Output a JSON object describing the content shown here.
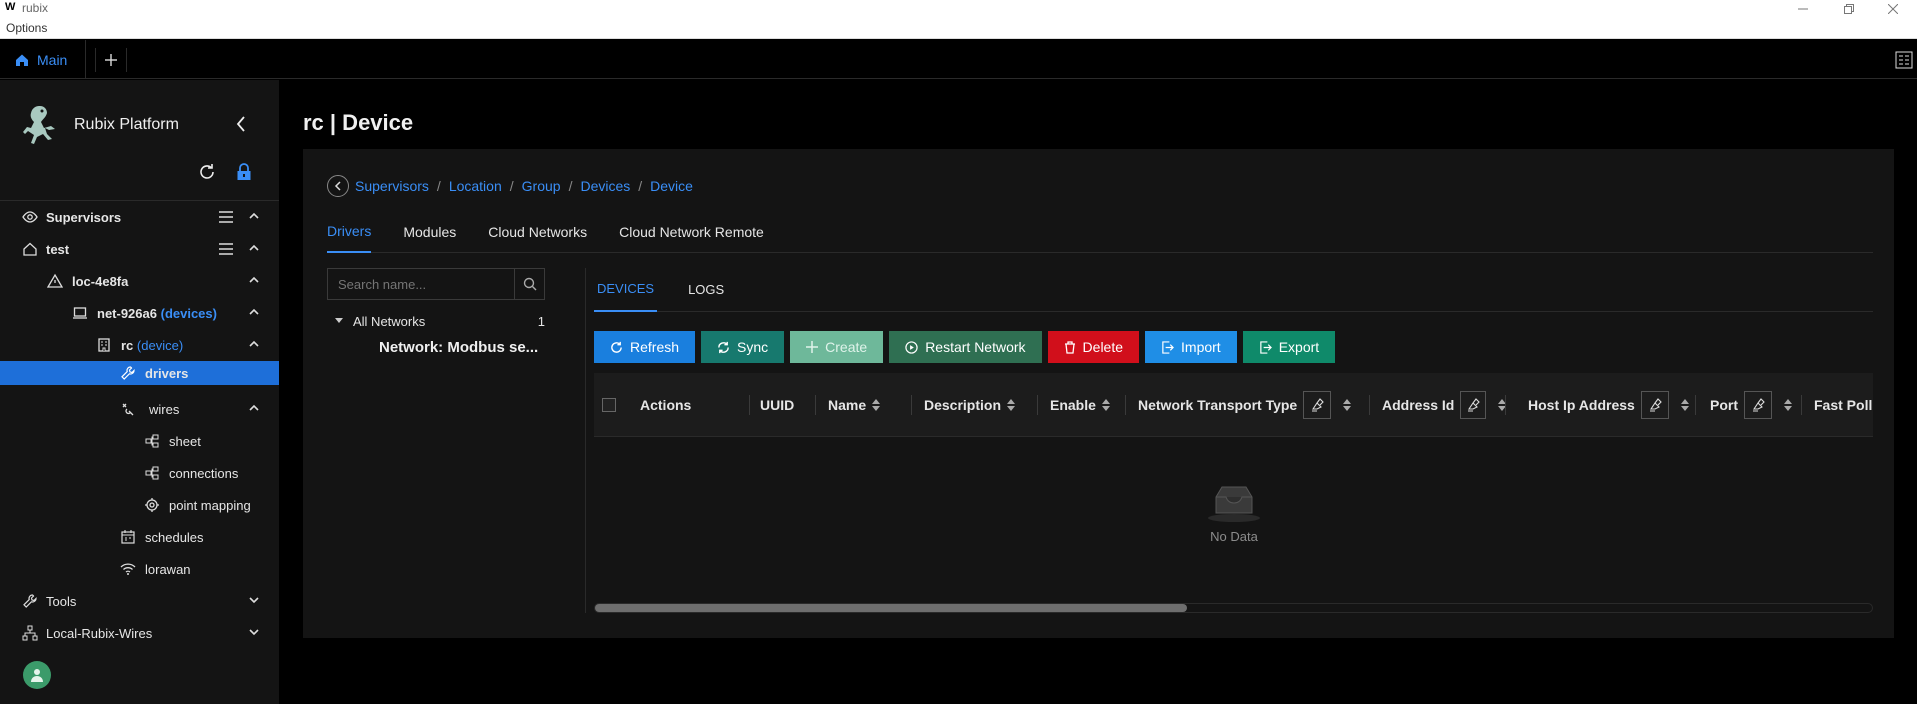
{
  "window": {
    "logo": "W",
    "title": "rubix",
    "menu": "Options"
  },
  "tabs": {
    "main_label": "Main"
  },
  "sidebar": {
    "brand": "Rubix Platform",
    "items": [
      {
        "label": "Supervisors"
      },
      {
        "label": "test"
      },
      {
        "label": "loc-4e8fa"
      },
      {
        "label": "net-926a6",
        "suffix": "(devices)"
      },
      {
        "label": "rc",
        "suffix": "(device)"
      },
      {
        "label": "drivers"
      },
      {
        "label": "wires"
      },
      {
        "label": "sheet"
      },
      {
        "label": "connections"
      },
      {
        "label": "point mapping"
      },
      {
        "label": "schedules"
      },
      {
        "label": "lorawan"
      },
      {
        "label": "Tools"
      },
      {
        "label": "Local-Rubix-Wires"
      }
    ]
  },
  "page": {
    "title": "rc | Device"
  },
  "breadcrumb": [
    "Supervisors",
    "Location",
    "Group",
    "Devices",
    "Device"
  ],
  "main_tabs": [
    "Drivers",
    "Modules",
    "Cloud Networks",
    "Cloud Network Remote"
  ],
  "search": {
    "placeholder": "Search name..."
  },
  "networks": {
    "root_label": "All Networks",
    "count": "1",
    "child": "Network: Modbus se..."
  },
  "sub_tabs": [
    "DEVICES",
    "LOGS"
  ],
  "actions": [
    "Refresh",
    "Sync",
    "Create",
    "Restart Network",
    "Delete",
    "Import",
    "Export"
  ],
  "table": {
    "columns": [
      "Actions",
      "UUID",
      "Name",
      "Description",
      "Enable",
      "Network Transport Type",
      "Address Id",
      "Host Ip Address",
      "Port",
      "Fast Poll Rat"
    ],
    "empty_text": "No Data"
  },
  "colors": {
    "accent": "#3a8ef6",
    "active_row": "#1e6fd9",
    "delete": "#d10f1b"
  }
}
